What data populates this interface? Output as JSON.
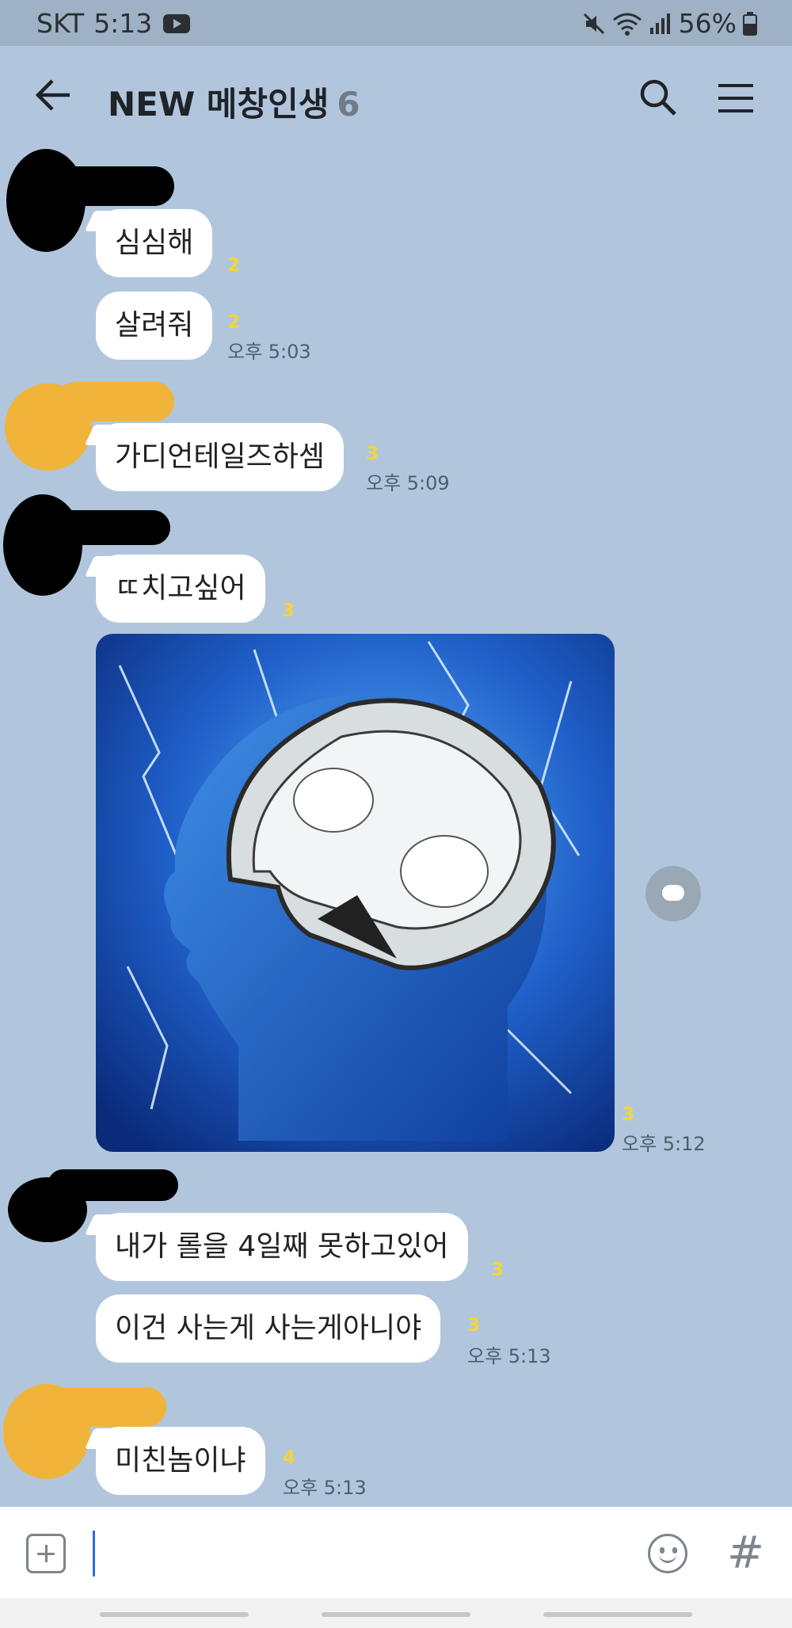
{
  "status_bar": {
    "carrier": "SKT",
    "time": "5:13",
    "battery": "56%"
  },
  "header": {
    "title": "NEW 메창인생",
    "member_count": "6"
  },
  "messages": [
    {
      "text": "심심해",
      "unread": "2"
    },
    {
      "text": "살려줘",
      "unread": "2",
      "time": "오후 5:03"
    },
    {
      "text": "가디언테일즈하셈",
      "unread": "3",
      "time": "오후 5:09"
    },
    {
      "text": "ㄸ치고싶어",
      "unread": "3"
    },
    {
      "image": "brain-lightning-photo",
      "unread": "3",
      "time": "오후 5:12"
    },
    {
      "text": "내가 롤을 4일째 못하고있어",
      "unread": "3"
    },
    {
      "text": "이건 사는게 사는게아니야",
      "unread": "3",
      "time": "오후 5:13"
    },
    {
      "text": "미친놈이냐",
      "unread": "4",
      "time": "오후 5:13"
    }
  ],
  "colors": {
    "background": "#b1c6dd",
    "unread": "#f4d635",
    "avatar_black": "#000000",
    "avatar_orange": "#f0b43a"
  },
  "icons": [
    "back-arrow-icon",
    "search-icon",
    "menu-icon",
    "share-icon",
    "plus-icon",
    "emoji-icon",
    "hash-icon"
  ]
}
